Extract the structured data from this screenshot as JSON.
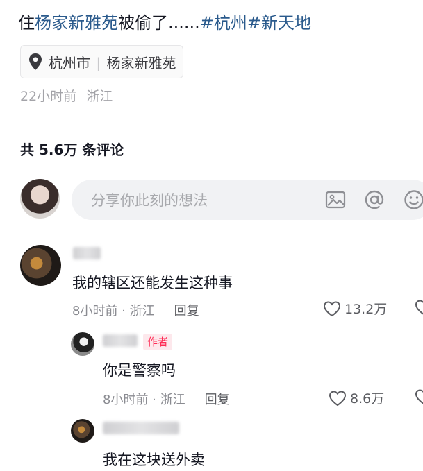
{
  "post": {
    "title_prefix": "住",
    "title_link": "杨家新雅苑",
    "title_suffix": "被偷了......",
    "hashtags": [
      "#杭州",
      "#新天地"
    ],
    "location": {
      "icon": "location-pin-icon",
      "city": "杭州市",
      "separator": "|",
      "place": "杨家新雅苑"
    },
    "time": "22小时前",
    "region": "浙江"
  },
  "comments_header": {
    "label": "共 5.6万 条评论"
  },
  "composer": {
    "placeholder": "分享你此刻的想法",
    "icons": [
      "image-icon",
      "at-icon",
      "emoji-icon"
    ]
  },
  "comments": [
    {
      "text": "我的辖区还能发生这种事",
      "meta": "8小时前 · 浙江",
      "reply_label": "回复",
      "likes": "13.2万"
    },
    {
      "badge": "作者",
      "text": "你是警察吗",
      "meta": "8小时前 · 浙江",
      "reply_label": "回复",
      "likes": "8.6万"
    },
    {
      "text": "我在这块送外卖"
    }
  ],
  "colors": {
    "link": "#2a5a8c",
    "badge_bg": "#fde8ec",
    "badge_text": "#fe2c55",
    "muted": "#a3a3a8"
  }
}
